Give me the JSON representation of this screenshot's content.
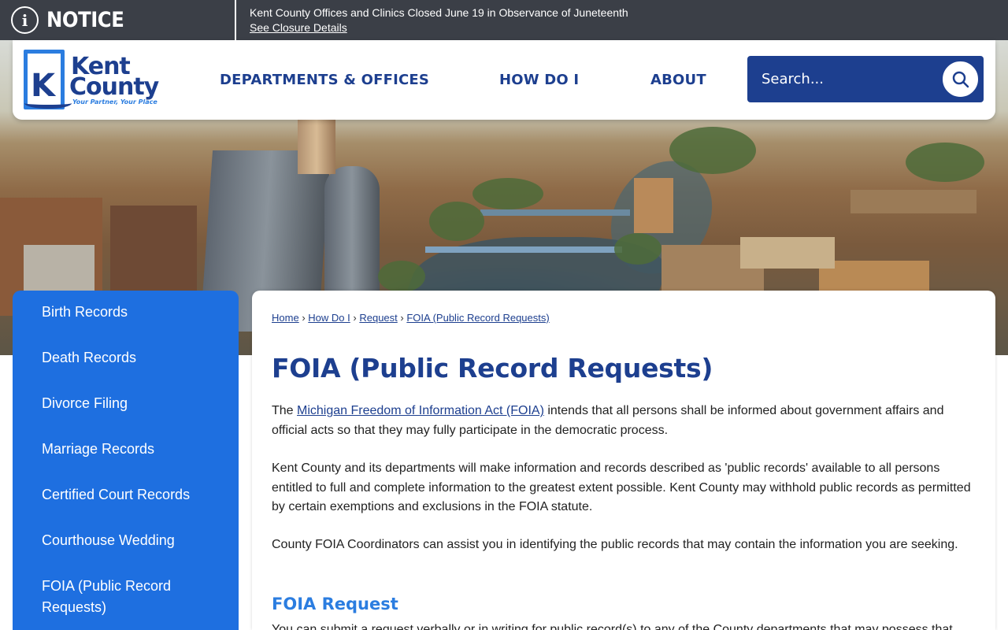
{
  "notice": {
    "label": "NOTICE",
    "icon": "info-icon",
    "message": "Kent County Offices and Clinics Closed June 19 in Observance of Juneteenth",
    "link": "See Closure Details"
  },
  "header": {
    "logo": {
      "line1": "Kent",
      "line2": "County",
      "tagline": "Your Partner, Your Place",
      "letter": "K"
    },
    "nav": [
      {
        "label": "DEPARTMENTS & OFFICES"
      },
      {
        "label": "HOW DO I"
      },
      {
        "label": "ABOUT"
      }
    ],
    "search": {
      "placeholder": "Search...",
      "icon": "search-icon"
    }
  },
  "sidebar": {
    "items": [
      {
        "label": "Birth Records"
      },
      {
        "label": "Death Records"
      },
      {
        "label": "Divorce Filing"
      },
      {
        "label": "Marriage Records"
      },
      {
        "label": "Certified Court Records"
      },
      {
        "label": "Courthouse Wedding"
      },
      {
        "label": "FOIA (Public Record Requests)"
      }
    ]
  },
  "main": {
    "breadcrumb": [
      {
        "label": "Home"
      },
      {
        "label": "How Do I"
      },
      {
        "label": "Request"
      },
      {
        "label": "FOIA (Public Record Requests)"
      }
    ],
    "breadcrumb_sep": "›",
    "title": "FOIA (Public Record Requests)",
    "p1_prefix": "The ",
    "p1_link": "Michigan Freedom of Information Act (FOIA)",
    "p1_suffix": " intends that all persons shall be informed about government affairs and official acts so that they may fully participate in the democratic process.",
    "p2": "Kent County and its departments will make information and records described as 'public records' available to all persons entitled to full and complete information to the greatest extent possible. Kent County may withhold public records as permitted by certain exemptions and exclusions in the FOIA statute.",
    "p3": "County FOIA Coordinators can assist you in identifying the public records that may contain the information you are seeking.",
    "subhead": "FOIA Request",
    "p4": "You can submit a request verbally or in writing for public record(s) to any of the County departments that may possess that"
  },
  "colors": {
    "navy": "#1d3f8f",
    "sidebar_blue": "#1e6fe0",
    "accent_blue": "#2b7de0",
    "notice_bg": "#3b3f47"
  }
}
